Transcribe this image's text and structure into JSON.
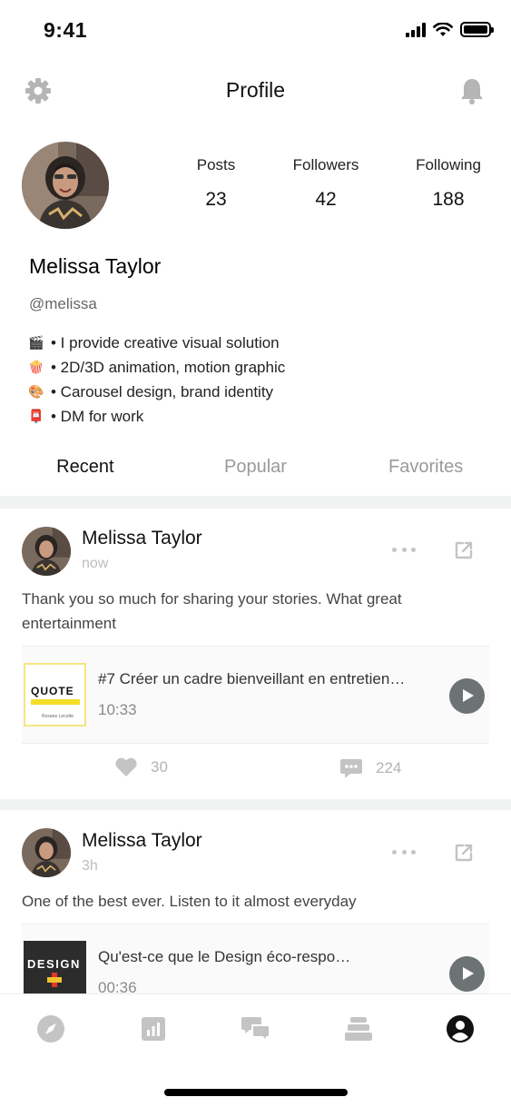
{
  "status_bar": {
    "time": "9:41"
  },
  "header": {
    "title": "Profile",
    "left_icon": "gear-icon",
    "right_icon": "bell-icon"
  },
  "profile": {
    "name": "Melissa Taylor",
    "handle": "@melissa",
    "stats": [
      {
        "label": "Posts",
        "value": "23"
      },
      {
        "label": "Followers",
        "value": "42"
      },
      {
        "label": "Following",
        "value": "188"
      }
    ],
    "bio": [
      {
        "emoji": "🎬",
        "text": "• I provide creative visual solution"
      },
      {
        "emoji": "🍿",
        "text": "• 2D/3D animation, motion graphic"
      },
      {
        "emoji": "🎨",
        "text": "• Carousel design, brand identity"
      },
      {
        "emoji": "📮",
        "text": "• DM for work"
      }
    ]
  },
  "tabs": [
    {
      "label": "Recent",
      "active": true
    },
    {
      "label": "Popular",
      "active": false
    },
    {
      "label": "Favorites",
      "active": false
    }
  ],
  "posts": [
    {
      "author": "Melissa Taylor",
      "time": "now",
      "text": "Thank you so much for sharing your stories. What great entertainment",
      "episode": {
        "title": "#7 Créer un cadre bienveillant en entretien…",
        "duration": "10:33",
        "cover": {
          "word": "QUOTE",
          "small_text": "Roxane Lecotte"
        }
      },
      "likes": "30",
      "comments": "224"
    },
    {
      "author": "Melissa Taylor",
      "time": "3h",
      "text": "One of the best ever. Listen to it almost everyday",
      "episode": {
        "title": "Qu'est-ce que le Design éco-respo…",
        "duration": "00:36",
        "cover": {
          "word": "DESIGN"
        }
      }
    }
  ],
  "bottom_nav": [
    {
      "icon": "compass-icon"
    },
    {
      "icon": "chart-icon"
    },
    {
      "icon": "chat-icon"
    },
    {
      "icon": "stack-icon"
    },
    {
      "icon": "user-icon",
      "active": true
    }
  ],
  "colors": {
    "accent": "#111111",
    "muted": "#b3b3b3",
    "play_button": "#6d7374",
    "divider": "#f1f2f2"
  }
}
